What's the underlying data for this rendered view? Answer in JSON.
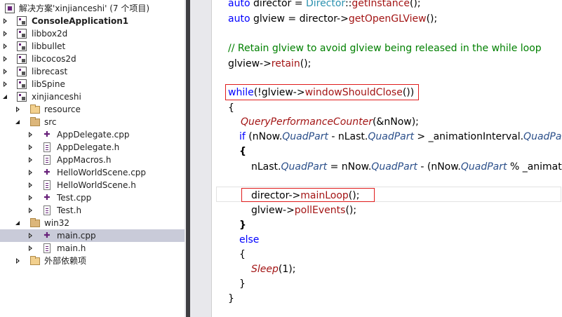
{
  "explorer": {
    "solution_label": "解决方案'xinjianceshi' (7 个项目)",
    "projects": [
      {
        "label": "ConsoleApplication1"
      },
      {
        "label": "libbox2d"
      },
      {
        "label": "libbullet"
      },
      {
        "label": "libcocos2d"
      },
      {
        "label": "librecast"
      },
      {
        "label": "libSpine"
      },
      {
        "label": "xinjianceshi"
      }
    ],
    "folders": {
      "resource": "resource",
      "src": "src",
      "win32": "win32",
      "external": "外部依赖项"
    },
    "src_files": [
      {
        "label": "AppDelegate.cpp"
      },
      {
        "label": "AppDelegate.h"
      },
      {
        "label": "AppMacros.h"
      },
      {
        "label": "HelloWorldScene.cpp"
      },
      {
        "label": "HelloWorldScene.h"
      },
      {
        "label": "Test.cpp"
      },
      {
        "label": "Test.h"
      }
    ],
    "win32_files": [
      {
        "label": "main.cpp"
      },
      {
        "label": "main.h"
      }
    ]
  },
  "editor": {
    "tokens": {
      "auto": "auto",
      "director": " director = ",
      "director_type": "Director",
      "scope": "::",
      "getInstance": "getInstance",
      "end_call": "();",
      "glview": " glview = director->",
      "getOpenGLView": "getOpenGLView",
      "comment": "// Retain glview to avoid glview being released in the while loop",
      "glview_arrow": "glview->",
      "retain": "retain",
      "while": "while",
      "while_cond_open": "(!glview->",
      "windowShouldClose": "windowShouldClose",
      "while_cond_close": "())",
      "brace_open": "{",
      "brace_close": "}",
      "qpc": "QueryPerformanceCounter",
      "qpc_args": "(&nNow);",
      "if": "if",
      "if_open": " (nNow.",
      "QuadPart": "QuadPart",
      "if_minus": " - nLast.",
      "if_gt": " > _animationInterval.",
      "assign_lhs": "nLast.",
      "assign_eq": " = nNow.",
      "assign_minus": " - (nNow.",
      "assign_mod": " % _animati",
      "director_arrow": "director->",
      "mainLoop": "mainLoop",
      "pollEvents": "pollEvents",
      "else": "else",
      "sleep": "Sleep",
      "sleep_args": "(1);"
    }
  },
  "colors": {
    "keyword": "#0000ff",
    "type": "#2b91af",
    "function": "#a31515",
    "comment": "#008000",
    "highlight_box": "#e01b1b",
    "selection": "#c9cbd9"
  }
}
